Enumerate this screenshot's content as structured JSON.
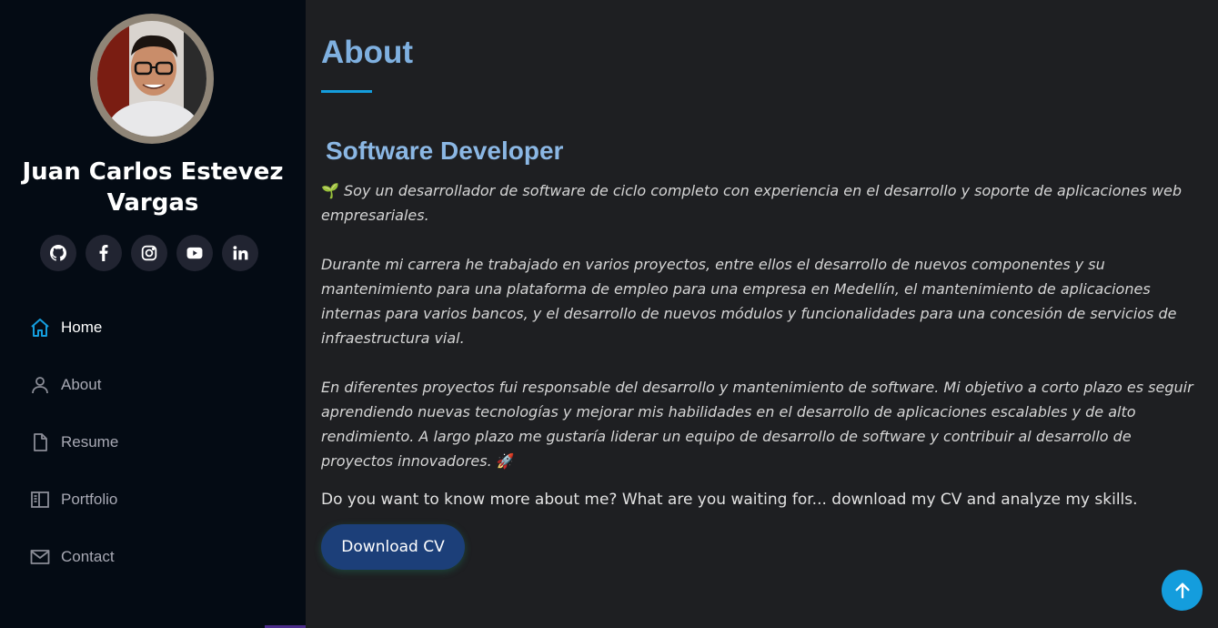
{
  "profile": {
    "name": "Juan Carlos Estevez Vargas"
  },
  "social": [
    {
      "icon": "github-icon"
    },
    {
      "icon": "facebook-icon"
    },
    {
      "icon": "instagram-icon"
    },
    {
      "icon": "youtube-icon"
    },
    {
      "icon": "linkedin-icon"
    }
  ],
  "nav": {
    "items": [
      {
        "label": "Home",
        "icon": "home-icon",
        "active": true
      },
      {
        "label": "About",
        "icon": "person-icon",
        "active": false
      },
      {
        "label": "Resume",
        "icon": "file-icon",
        "active": false
      },
      {
        "label": "Portfolio",
        "icon": "book-half-icon",
        "active": false
      },
      {
        "label": "Contact",
        "icon": "envelope-icon",
        "active": false
      }
    ]
  },
  "main": {
    "section_title": "About",
    "role_title": "Software Developer",
    "bio": {
      "p1_emoji": "🌱",
      "p1": "Soy un desarrollador de software de ciclo completo con experiencia en el desarrollo y soporte de aplicaciones web empresariales.",
      "p2": "Durante mi carrera he trabajado en varios proyectos, entre ellos el desarrollo de nuevos componentes y su mantenimiento para una plataforma de empleo para una empresa en Medellín, el mantenimiento de aplicaciones internas para varios bancos, y el desarrollo de nuevos módulos y funcionalidades para una concesión de servicios de infraestructura vial.",
      "p3": "En diferentes proyectos fui responsable del desarrollo y mantenimiento de software. Mi objetivo a corto plazo es seguir aprendiendo nuevas tecnologías y mejorar mis habilidades en el desarrollo de aplicaciones escalables y de alto rendimiento. A largo plazo me gustaría liderar un equipo de desarrollo de software y contribuir al desarrollo de proyectos innovadores.",
      "p3_emoji": "🚀"
    },
    "cta_text": "Do you want to know more about me? What are you waiting for... download my CV and analyze my skills.",
    "download_label": "Download CV"
  },
  "colors": {
    "sidebar_bg": "#040b14",
    "main_bg": "#1e1f22",
    "accent": "#149ddd",
    "title": "#7fb0e0",
    "button": "#1c3f79"
  }
}
